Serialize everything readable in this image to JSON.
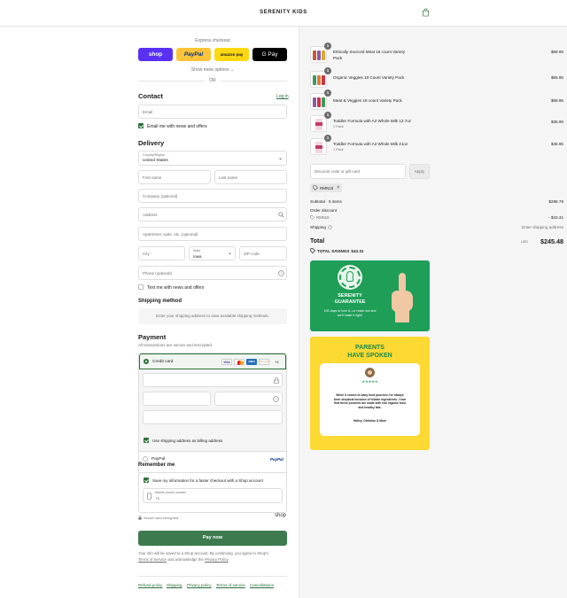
{
  "header": {
    "brand": "SERENITY KIDS",
    "cart_icon": "shopping-bag-icon"
  },
  "express": {
    "title": "Express checkout",
    "buttons": [
      {
        "label": "shop",
        "color": "#5a31f4"
      },
      {
        "label": "PayPal",
        "color": "#ffc439"
      },
      {
        "label": "amazon pay",
        "color": "#ffd814"
      },
      {
        "label": "G Pay",
        "color": "#000000"
      }
    ],
    "more_label": "Show more options",
    "or_label": "OR"
  },
  "contact": {
    "title": "Contact",
    "login_label": "Log in",
    "email_placeholder": "Email",
    "news_label": "Email me with news and offers"
  },
  "delivery": {
    "title": "Delivery",
    "country_label": "Country/Region",
    "country_value": "United States",
    "first_name": "First name",
    "last_name": "Last name",
    "company": "Company (optional)",
    "address": "Address",
    "apartment": "Apartment, suite, etc. (optional)",
    "city": "City",
    "state_label": "State",
    "state_value": "Iowa",
    "zip": "ZIP code",
    "phone": "Phone (optional)",
    "text_label": "Text me with news and offers"
  },
  "shipping": {
    "title": "Shipping method",
    "note": "Enter your shipping address to view available shipping methods."
  },
  "payment": {
    "title": "Payment",
    "subtitle": "All transactions are secure and encrypted.",
    "credit_card_label": "Credit card",
    "card_brands": [
      "VISA",
      "MC",
      "AMEX",
      "DISCOVER"
    ],
    "more_cards": "+4",
    "billing_label": "Use shipping address as billing address",
    "paypal_label": "PayPal",
    "paypal_logo": "PayPal"
  },
  "remember": {
    "title": "Remember me",
    "save_label": "Save my information for a faster checkout with a Shop account",
    "mobile_label": "Mobile phone number",
    "mobile_value": "+1",
    "secure_label": "Secure and encrypted",
    "shop_logo": "shop"
  },
  "pay": {
    "button_label": "Pay now",
    "terms_line1": "Your info will be saved to a Shop account. By continuing, you agree to Shop's",
    "terms_link1": "Terms of Service",
    "terms_mid": " and acknowledge the ",
    "terms_link2": "Privacy Policy",
    "terms_end": "."
  },
  "footer": {
    "links": [
      "Refund policy",
      "Shipping",
      "Privacy policy",
      "Terms of service",
      "Cancellations"
    ]
  },
  "order": {
    "items": [
      {
        "name": "Ethically Sourced Meat 18 count Variety Pack",
        "qty": "1",
        "variant": "",
        "price": "$69.95"
      },
      {
        "name": "Organic Veggies 18 Count Variety Pack",
        "qty": "1",
        "variant": "",
        "price": "$65.95"
      },
      {
        "name": "Meat & Veggies 18 count Variety Pack",
        "qty": "1",
        "variant": "",
        "price": "$69.95"
      },
      {
        "name": "Toddler Formula with A2 Whole Milk 12.7oz",
        "qty": "1",
        "variant": "1 Pack",
        "price": "$35.99"
      },
      {
        "name": "Toddler Formula with A2 Whole Milk 21oz",
        "qty": "1",
        "variant": "1 Pack",
        "price": "$46.95"
      }
    ],
    "discount_placeholder": "Discount code or gift card",
    "apply_label": "Apply",
    "code_tag": "RMN15",
    "subtotal_label": "Subtotal · 5 items",
    "subtotal_value": "$288.79",
    "order_discount_label": "Order discount",
    "discount_code": "RMN15",
    "discount_value": "- $43.31",
    "shipping_label": "Shipping",
    "shipping_value": "Enter shipping address",
    "total_label": "Total",
    "currency": "USD",
    "total_value": "$245.48",
    "savings_label": "TOTAL SAVINGS",
    "savings_value": "$43.31"
  },
  "guarantee": {
    "title_line1": "SERENITY",
    "title_line2": "GUARANTEE",
    "text": "100 days to love it—or reach out and we'll make it right!",
    "bg": "#1e9e57"
  },
  "testimonial": {
    "title_line1": "PARENTS",
    "title_line2": "HAVE SPOKEN",
    "stars": "★★★★★",
    "quote": "When it comes to baby food pouches I've always been skeptical because of hidden ingredients. I love that these pouches are made with real organic food and healthy fats.",
    "author": "Hailey, Dietician & Mom",
    "bg": "#fcd933",
    "title_color": "#1a8a4a"
  },
  "colors": {
    "accent": "#2e6e3c",
    "link": "#2e6e3c"
  }
}
